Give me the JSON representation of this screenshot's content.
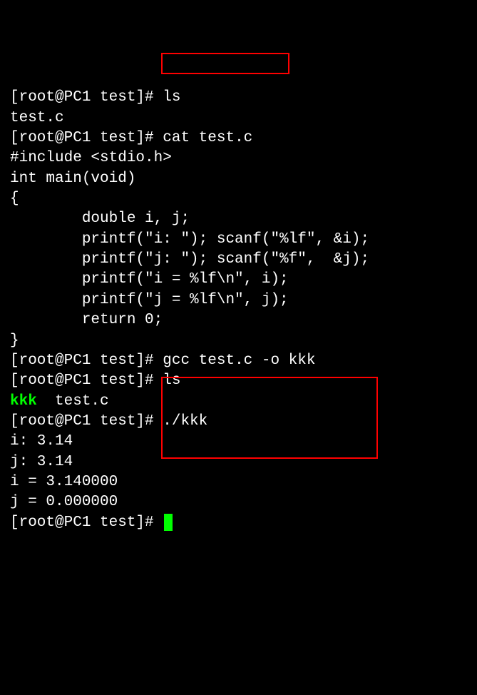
{
  "lines": {
    "l1_prompt": "[root@PC1 test]# ",
    "l1_cmd": "ls",
    "l2": "test.c",
    "l3_prompt": "[root@PC1 test]# ",
    "l3_cmd": "cat test.c",
    "l4": "#include <stdio.h>",
    "l5": "",
    "l6": "int main(void)",
    "l7": "{",
    "l8": "        double i, j;",
    "l9": "",
    "l10": "        printf(\"i: \"); scanf(\"%lf\", &i);",
    "l11": "        printf(\"j: \"); scanf(\"%f\",  &j);",
    "l12": "",
    "l13": "        printf(\"i = %lf\\n\", i);",
    "l14": "        printf(\"j = %lf\\n\", j);",
    "l15": "",
    "l16": "        return 0;",
    "l17": "}",
    "l18_prompt": "[root@PC1 test]# ",
    "l18_cmd": "gcc test.c -o kkk",
    "l19_prompt": "[root@PC1 test]# ",
    "l19_cmd": "ls",
    "l20_exec": "kkk",
    "l20_rest": "  test.c",
    "l21_prompt": "[root@PC1 test]# ",
    "l21_cmd": "./kkk",
    "l22": "i: 3.14",
    "l23": "j: 3.14",
    "l24": "i = 3.140000",
    "l25": "j = 0.000000",
    "l26_prompt": "[root@PC1 test]# "
  }
}
